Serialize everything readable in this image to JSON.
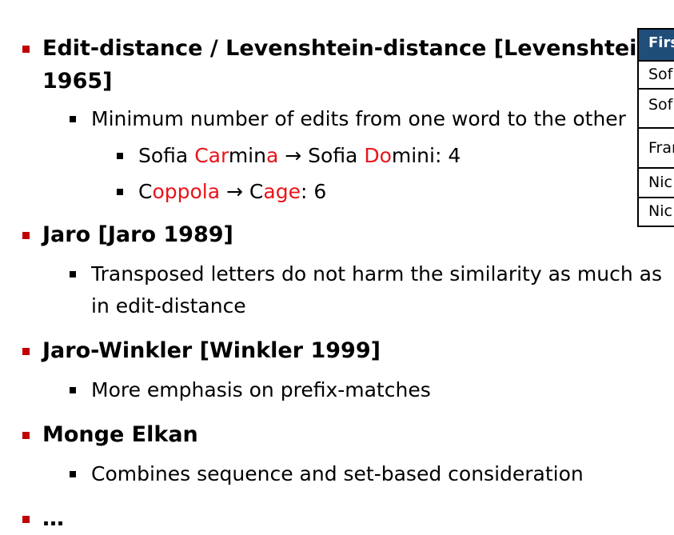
{
  "items": [
    {
      "label_line1": "Edit-distance / Levenshtein-distance [Levenshtein",
      "label_line2": "1965]",
      "sub": "Minimum number of edits from one word to the other",
      "examples": [
        {
          "a_pre": "Sofia ",
          "a_red1": "Car",
          "a_mid": "min",
          "a_red2": "a",
          "arrow": "→",
          "b_pre": " Sofia ",
          "b_red1": "Do",
          "b_mid": "mini",
          "b_post": ": 4"
        },
        {
          "a_pre": "C",
          "a_red1": "oppola",
          "arrow": "→",
          "b_pre": " C",
          "b_red1": "age",
          "b_post": ": 6"
        }
      ]
    },
    {
      "label": "Jaro [Jaro 1989]",
      "sub_line1": "Transposed letters do not harm the similarity as much as",
      "sub_line2": "in edit-distance"
    },
    {
      "label": "Jaro-Winkler [Winkler 1999]",
      "sub": "More emphasis on prefix-matches"
    },
    {
      "label": "Monge Elkan",
      "sub": "Combines sequence and set-based consideration"
    },
    {
      "label": "…"
    }
  ],
  "table": {
    "header": "Firs",
    "rows": [
      "Sof",
      "Sof",
      "Fran",
      "Nic",
      "Nic"
    ]
  },
  "colors": {
    "bullet": "#c00000",
    "highlight": "#e8141a",
    "table_header": "#1f4e79"
  }
}
